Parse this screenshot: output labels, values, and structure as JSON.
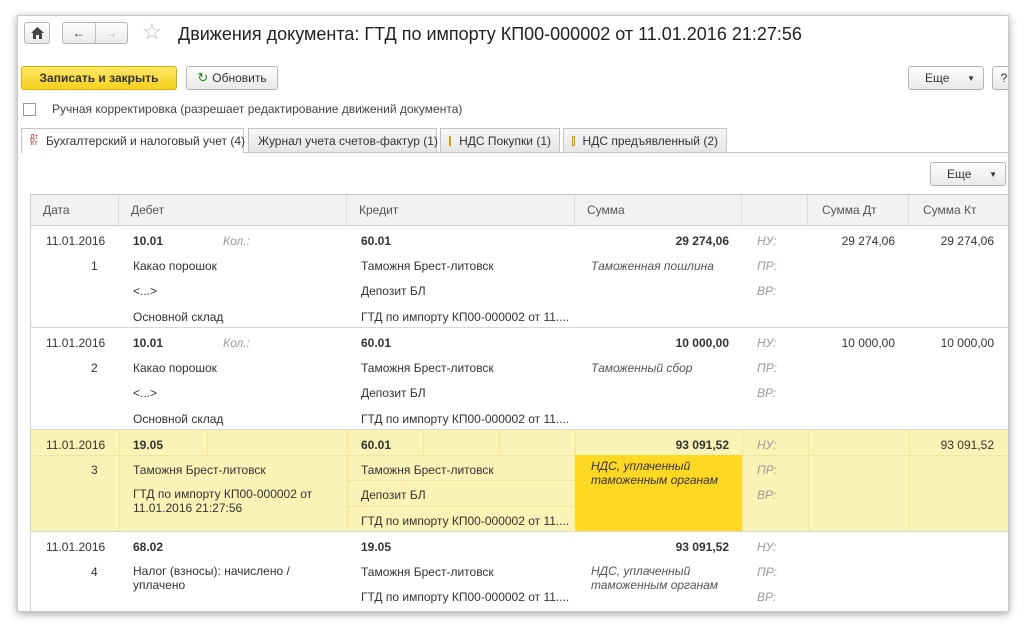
{
  "nav": {
    "back": "←",
    "forward": "→"
  },
  "title": "Движения документа: ГТД по импорту КП00-000002 от 11.01.2016 21:27:56",
  "toolbar": {
    "save_close": "Записать и закрыть",
    "refresh": "Обновить",
    "more": "Еще",
    "help": "?"
  },
  "manual": {
    "label": "Ручная корректировка (разрешает редактирование движений документа)"
  },
  "tabs": [
    {
      "label": "Бухгалтерский и налоговый учет (4)",
      "icon": "dt-kt-icon",
      "icon_text_top": "Дт",
      "icon_text_bottom": "Кт"
    },
    {
      "label": "Журнал учета счетов-фактур (1)"
    },
    {
      "label": "НДС Покупки (1)",
      "icon": "register-icon"
    },
    {
      "label": "НДС предъявленный (2)",
      "icon": "register-icon"
    }
  ],
  "table_more": "Еще",
  "columns": {
    "date": "Дата",
    "debit": "Дебет",
    "credit": "Кредит",
    "sum": "Сумма",
    "sum_dt": "Сумма Дт",
    "sum_kt": "Сумма Кт"
  },
  "records": [
    {
      "date": "11.01.2016",
      "num": "1",
      "debit_account": "10.01",
      "qty": "Кол.:",
      "debit_sub": [
        "Какао порошок",
        "<...>",
        "Основной склад"
      ],
      "credit_account": "60.01",
      "credit_sub": [
        "Таможня Брест-литовск",
        "Депозит БЛ",
        "ГТД по импорту КП00-000002 от 11...."
      ],
      "sum": "29 274,06",
      "content": "Таможенная пошлина",
      "nu": "НУ:",
      "pr": "ПР:",
      "vr": "ВР:",
      "sum_dt": "29 274,06",
      "sum_kt": "29 274,06"
    },
    {
      "date": "11.01.2016",
      "num": "2",
      "debit_account": "10.01",
      "qty": "Кол.:",
      "debit_sub": [
        "Какао порошок",
        "<...>",
        "Основной склад"
      ],
      "credit_account": "60.01",
      "credit_sub": [
        "Таможня Брест-литовск",
        "Депозит БЛ",
        "ГТД по импорту КП00-000002 от 11...."
      ],
      "sum": "10 000,00",
      "content": "Таможенный сбор",
      "nu": "НУ:",
      "pr": "ПР:",
      "vr": "ВР:",
      "sum_dt": "10 000,00",
      "sum_kt": "10 000,00"
    },
    {
      "date": "11.01.2016",
      "num": "3",
      "debit_account": "19.05",
      "debit_sub": [
        "Таможня Брест-литовск",
        "ГТД по импорту КП00-000002 от 11.01.2016 21:27:56"
      ],
      "credit_account": "60.01",
      "credit_sub": [
        "Таможня Брест-литовск",
        "Депозит БЛ",
        "ГТД по импорту КП00-000002 от 11...."
      ],
      "sum": "93 091,52",
      "content": "НДС, уплаченный таможенным органам",
      "nu": "НУ:",
      "pr": "ПР:",
      "vr": "ВР:",
      "sum_dt": "",
      "sum_kt": "93 091,52"
    },
    {
      "date": "11.01.2016",
      "num": "4",
      "debit_account": "68.02",
      "debit_sub": [
        "Налог (взносы): начислено / уплачено"
      ],
      "credit_account": "19.05",
      "credit_sub": [
        "Таможня Брест-литовск",
        "ГТД по импорту КП00-000002 от 11...."
      ],
      "sum": "93 091,52",
      "content": "НДС, уплаченный таможенным органам",
      "nu": "НУ:",
      "pr": "ПР:",
      "vr": "ВР:",
      "sum_dt": "",
      "sum_kt": ""
    }
  ]
}
